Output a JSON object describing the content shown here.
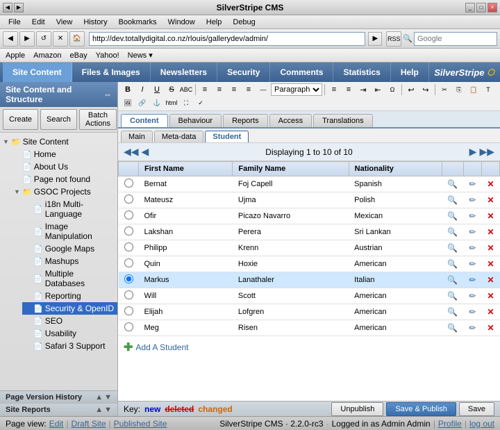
{
  "window": {
    "title": "SilverStripe CMS",
    "controls": [
      "_",
      "□",
      "×"
    ]
  },
  "menu_bar": {
    "items": [
      "File",
      "Edit",
      "View",
      "History",
      "Bookmarks",
      "Window",
      "Help",
      "Debug"
    ]
  },
  "toolbar": {
    "address": "http://dev.totallydigital.co.nz/rlouis/gallerydev/admin/",
    "search_placeholder": "Google",
    "go_label": "▶"
  },
  "bookmark_bar": {
    "items": [
      "Apple",
      "Amazon",
      "eBay",
      "Yahoo!",
      "News ▾"
    ]
  },
  "app_tabs": {
    "items": [
      {
        "label": "Site Content",
        "active": true
      },
      {
        "label": "Files & Images",
        "active": false
      },
      {
        "label": "Newsletters",
        "active": false
      },
      {
        "label": "Security",
        "active": false
      },
      {
        "label": "Comments",
        "active": false
      },
      {
        "label": "Statistics",
        "active": false
      },
      {
        "label": "Help",
        "active": false
      }
    ],
    "logo": "SilverStripe ◈"
  },
  "sidebar": {
    "header": "Site Content and Structure",
    "actions": [
      "Create",
      "Search",
      "Batch Actions"
    ],
    "tree": [
      {
        "label": "Site Content",
        "type": "root",
        "icon": "📁",
        "level": 0
      },
      {
        "label": "Home",
        "type": "page",
        "icon": "📄",
        "level": 1
      },
      {
        "label": "About Us",
        "type": "page",
        "icon": "📄",
        "level": 1
      },
      {
        "label": "Page not found",
        "type": "page",
        "icon": "📄",
        "level": 1
      },
      {
        "label": "GSOC Projects",
        "type": "folder",
        "icon": "📁",
        "level": 1,
        "expanded": true
      },
      {
        "label": "i18n Multi-Language",
        "type": "page",
        "icon": "📄",
        "level": 2
      },
      {
        "label": "Image Manipulation",
        "type": "page",
        "icon": "📄",
        "level": 2
      },
      {
        "label": "Google Maps",
        "type": "page",
        "icon": "📄",
        "level": 2
      },
      {
        "label": "Mashups",
        "type": "page",
        "icon": "📄",
        "level": 2
      },
      {
        "label": "Multiple Databases",
        "type": "page",
        "icon": "📄",
        "level": 2
      },
      {
        "label": "Reporting",
        "type": "page",
        "icon": "📄",
        "level": 2
      },
      {
        "label": "Security & OpenID",
        "type": "page",
        "icon": "📄",
        "level": 2,
        "selected": true
      },
      {
        "label": "SEO",
        "type": "page",
        "icon": "📄",
        "level": 2
      },
      {
        "label": "Usability",
        "type": "page",
        "icon": "📄",
        "level": 2
      },
      {
        "label": "Safari 3 Support",
        "type": "page",
        "icon": "📄",
        "level": 2
      }
    ]
  },
  "editor": {
    "toolbar_buttons": [
      {
        "label": "B",
        "title": "Bold"
      },
      {
        "label": "I",
        "title": "Italic"
      },
      {
        "label": "U",
        "title": "Underline"
      },
      {
        "label": "ABC̶",
        "title": "Strikethrough"
      }
    ],
    "format_select": "Paragraph"
  },
  "content_tabs": {
    "items": [
      {
        "label": "Content",
        "active": true
      },
      {
        "label": "Behaviour",
        "active": false
      },
      {
        "label": "Reports",
        "active": false
      },
      {
        "label": "Access",
        "active": false
      },
      {
        "label": "Translations",
        "active": false
      }
    ]
  },
  "sub_tabs": {
    "items": [
      {
        "label": "Main",
        "active": false
      },
      {
        "label": "Meta-data",
        "active": false
      },
      {
        "label": "Student",
        "active": true
      }
    ]
  },
  "student_table": {
    "nav": {
      "prev_arrow": "◀",
      "next_arrow": "▶",
      "last_arrow": "▶▶",
      "display_text": "Displaying 1 to 10 of 10",
      "first_arrow": "◀◀"
    },
    "columns": [
      "",
      "First Name",
      "Family Name",
      "Nationality",
      "",
      "",
      ""
    ],
    "rows": [
      {
        "id": 1,
        "first": "Bernat",
        "family": "Foj Capell",
        "nationality": "Spanish",
        "selected": false
      },
      {
        "id": 2,
        "first": "Mateusz",
        "family": "Ujma",
        "nationality": "Polish",
        "selected": false
      },
      {
        "id": 3,
        "first": "Ofir",
        "family": "Picazo Navarro",
        "nationality": "Mexican",
        "selected": false
      },
      {
        "id": 4,
        "first": "Lakshan",
        "family": "Perera",
        "nationality": "Sri Lankan",
        "selected": false
      },
      {
        "id": 5,
        "first": "Philipp",
        "family": "Krenn",
        "nationality": "Austrian",
        "selected": false
      },
      {
        "id": 6,
        "first": "Quin",
        "family": "Hoxie",
        "nationality": "American",
        "selected": false
      },
      {
        "id": 7,
        "first": "Markus",
        "family": "Lanathaler",
        "nationality": "Italian",
        "selected": true
      },
      {
        "id": 8,
        "first": "Will",
        "family": "Scott",
        "nationality": "American",
        "selected": false
      },
      {
        "id": 9,
        "first": "Elijah",
        "family": "Lofgren",
        "nationality": "American",
        "selected": false
      },
      {
        "id": 10,
        "first": "Meg",
        "family": "Risen",
        "nationality": "American",
        "selected": false
      }
    ],
    "add_label": "Add A Student"
  },
  "key_legend": {
    "prefix": "Key:",
    "new": "new",
    "deleted": "deleted",
    "changed": "changed"
  },
  "bottom_actions": {
    "unpublish": "Unpublish",
    "save_publish": "Save & Publish",
    "save": "Save"
  },
  "sidebar_bottom": {
    "page_version": "Page Version History",
    "site_reports": "Site Reports"
  },
  "status_bar": {
    "page_view": "Page view:",
    "edit": "Edit",
    "draft_site": "Draft Site",
    "published_site": "Published Site",
    "cms_version": "SilverStripe CMS · 2.2.0-rc3",
    "logged_in": "Logged in as Admin Admin",
    "profile": "Profile",
    "log_out": "log out"
  }
}
